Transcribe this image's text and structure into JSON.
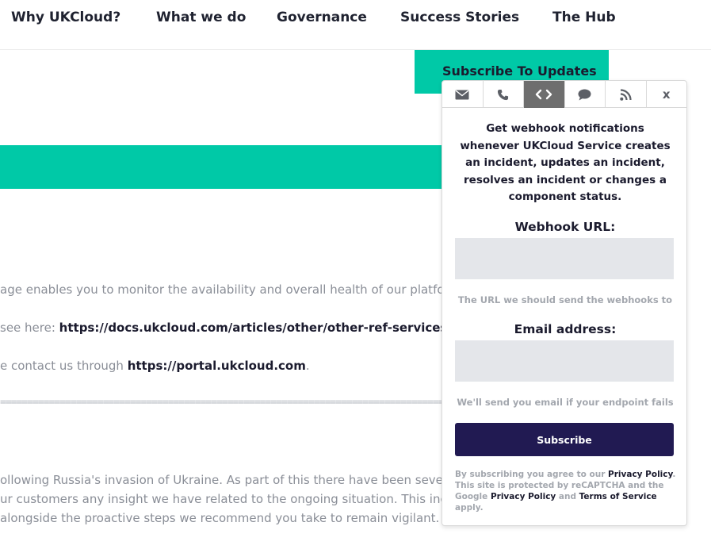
{
  "nav": {
    "items": [
      "Why UKCloud?",
      "What we do",
      "Governance",
      "Success Stories",
      "The Hub"
    ]
  },
  "subscribe_updates_label": "Subscribe To Updates",
  "content": {
    "p1": "age enables you to monitor the availability and overall health of our platforms.",
    "p2_prefix": " see here: ",
    "p2_link": "https://docs.ukcloud.com/articles/other/other-ref-services-by-re",
    "p3_prefix": "e contact us through ",
    "p3_link": "https://portal.ukcloud.com",
    "p3_suffix": ".",
    "divider": "===========================================================================================",
    "p4": "ollowing Russia's invasion of Ukraine. As part of this there have been several re",
    "p5": "ur customers any insight we have related to the ongoing situation. This includes",
    "p6": "alongside the proactive steps we recommend you take to remain vigilant."
  },
  "popup": {
    "tabs": [
      {
        "icon": "envelope-icon",
        "active": false
      },
      {
        "icon": "phone-icon",
        "active": false
      },
      {
        "icon": "code-icon",
        "active": true
      },
      {
        "icon": "chat-bubble-icon",
        "active": false
      },
      {
        "icon": "rss-icon",
        "active": false
      }
    ],
    "close_label": "x",
    "description": "Get webhook notifications whenever UKCloud Service creates an incident, updates an incident, resolves an incident or changes a component status.",
    "webhook_label": "Webhook URL:",
    "webhook_value": "",
    "webhook_hint": "The URL we should send the webhooks to",
    "email_label": "Email address:",
    "email_value": "",
    "email_hint": "We'll send you email if your endpoint fails",
    "subscribe_label": "Subscribe",
    "legal": {
      "t1": "By subscribing you agree to our ",
      "privacy": "Privacy Policy",
      "t2": ". This site is protected by reCAPTCHA and the Google ",
      "google_privacy": "Privacy Policy",
      "t3": " and ",
      "terms": "Terms of Service",
      "t4": " apply."
    }
  },
  "colors": {
    "accent": "#00c9a7",
    "button": "#211a52",
    "active_tab": "#6e6e6e"
  }
}
